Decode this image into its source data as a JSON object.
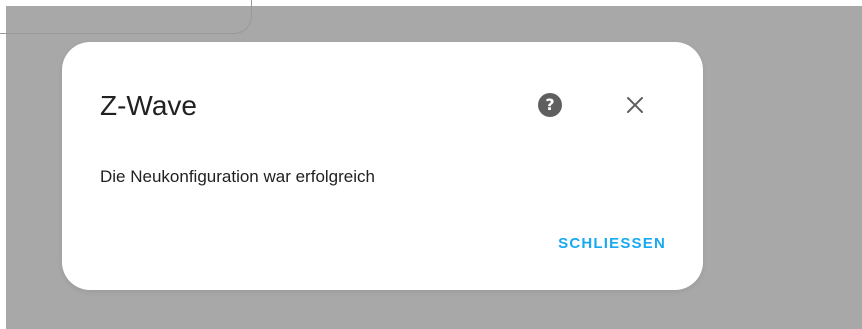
{
  "dialog": {
    "title": "Z-Wave",
    "message": "Die Neukonfiguration war erfolgreich",
    "help_icon": "help-circle-icon",
    "help_glyph": "?",
    "close_icon": "close-icon",
    "action_label": "SCHLIESSEN"
  },
  "colors": {
    "scrim": "#a8a8a8",
    "dialog_background": "#ffffff",
    "accent": "#18a9f0",
    "title_text": "#212121",
    "icon": "#5f5f5f"
  }
}
